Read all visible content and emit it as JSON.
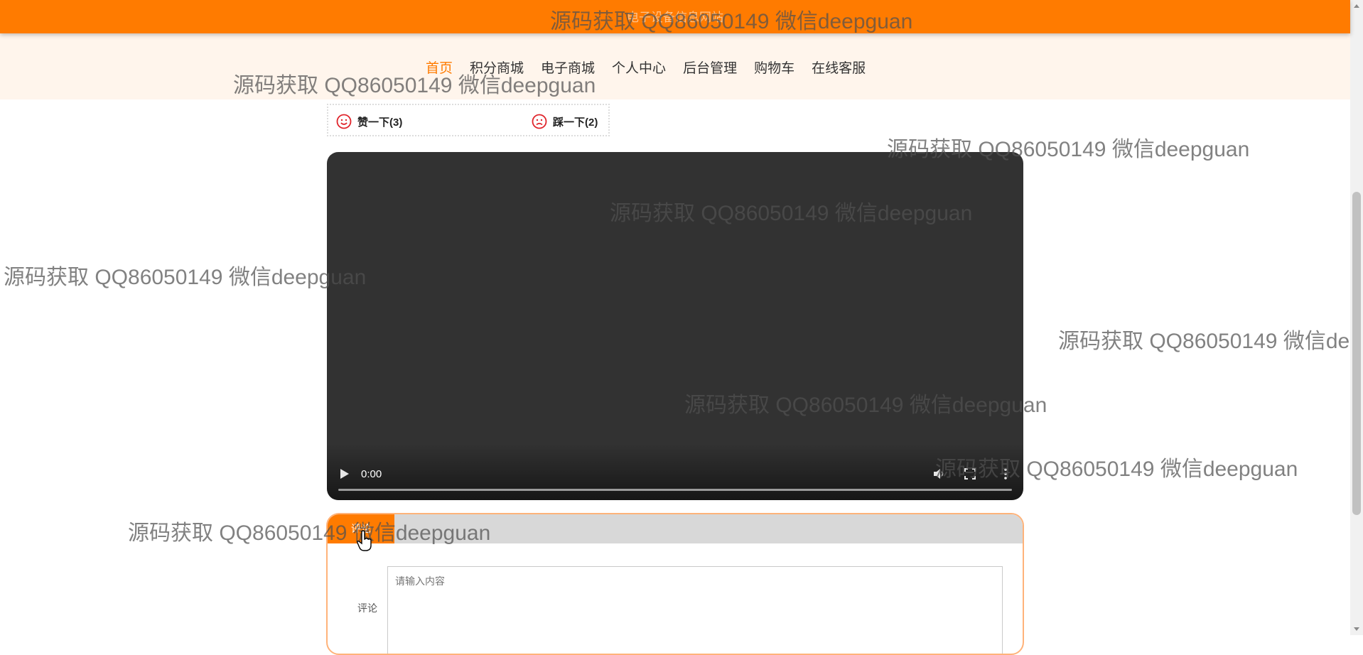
{
  "header": {
    "site_title": "电子设备信息网站"
  },
  "nav": {
    "items": [
      {
        "label": "首页",
        "active": true
      },
      {
        "label": "积分商城",
        "active": false
      },
      {
        "label": "电子商城",
        "active": false
      },
      {
        "label": "个人中心",
        "active": false
      },
      {
        "label": "后台管理",
        "active": false
      },
      {
        "label": "购物车",
        "active": false
      },
      {
        "label": "在线客服",
        "active": false
      }
    ]
  },
  "votes": {
    "like_label": "赞一下(3)",
    "dislike_label": "踩一下(2)"
  },
  "video": {
    "time": "0:00",
    "progress": 0
  },
  "comment": {
    "tab_label": "评论",
    "field_label": "评论",
    "placeholder": "请输入内容",
    "value": ""
  },
  "watermark": {
    "text": "源码获取 QQ86050149 微信deepguan"
  },
  "colors": {
    "accent": "#ff7b00",
    "nav_bg": "#fff5ec",
    "video_bg": "#323232"
  }
}
